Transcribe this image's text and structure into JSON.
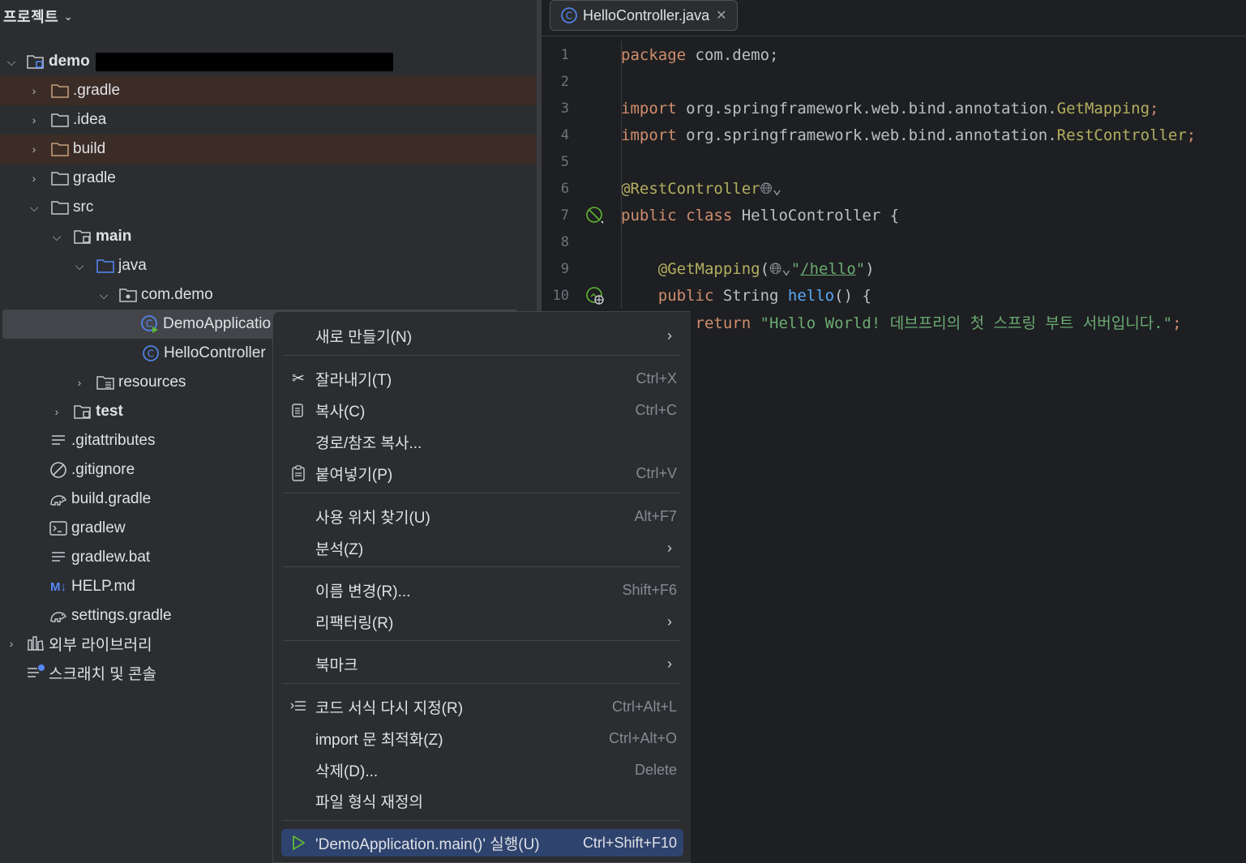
{
  "project_panel": {
    "title": "프로젝트",
    "tree": [
      {
        "label": "demo",
        "bold": true
      },
      {
        "label": ".gradle"
      },
      {
        "label": ".idea"
      },
      {
        "label": "build"
      },
      {
        "label": "gradle"
      },
      {
        "label": "src"
      },
      {
        "label": "main",
        "bold": true
      },
      {
        "label": "java"
      },
      {
        "label": "com.demo"
      },
      {
        "label": "DemoApplicatio"
      },
      {
        "label": "HelloController"
      },
      {
        "label": "resources"
      },
      {
        "label": "test",
        "bold": true
      },
      {
        "label": ".gitattributes"
      },
      {
        "label": ".gitignore"
      },
      {
        "label": "build.gradle"
      },
      {
        "label": "gradlew"
      },
      {
        "label": "gradlew.bat"
      },
      {
        "label": "HELP.md",
        "badge": "M↓"
      },
      {
        "label": "settings.gradle"
      },
      {
        "label": "외부 라이브러리"
      },
      {
        "label": "스크래치 및 콘솔"
      }
    ]
  },
  "editor": {
    "tab": {
      "label": "HelloController.java"
    },
    "code": {
      "line_numbers": [
        "1",
        "2",
        "3",
        "4",
        "5",
        "6",
        "7",
        "8",
        "9",
        "10"
      ],
      "l1_kw": "package",
      "l1_rest": " com.demo;",
      "l3_kw": "import",
      "l3_rest": " org.springframework.web.bind.annotation.",
      "l3_cls": "GetMapping",
      "l3_end": ";",
      "l4_kw": "import",
      "l4_rest": " org.springframework.web.bind.annotation.",
      "l4_cls": "RestController",
      "l4_end": ";",
      "l6_ann": "@RestController",
      "l7_kw": "public class",
      "l7_rest": " HelloController {",
      "l9_ann": "@GetMapping",
      "l9_open": "(",
      "l9_q1": "\"",
      "l9_path": "/hello",
      "l9_q2": "\"",
      "l9_close": ")",
      "l10_kw": "public",
      "l10_type": " String ",
      "l10_fn": "hello",
      "l10_rest": "() {",
      "l11_kw": "return",
      "l11_str": " \"Hello World! 데브프리의 첫 스프링 부트 서버입니다.\"",
      "l11_end": ";"
    }
  },
  "context_menu": {
    "items": [
      {
        "label": "새로 만들기(N)",
        "submenu": true
      },
      {
        "label": "잘라내기(T)",
        "shortcut": "Ctrl+X",
        "icon": "scissors-icon"
      },
      {
        "label": "복사(C)",
        "shortcut": "Ctrl+C",
        "icon": "copy-icon"
      },
      {
        "label": "경로/참조 복사..."
      },
      {
        "label": "붙여넣기(P)",
        "shortcut": "Ctrl+V",
        "icon": "paste-icon"
      },
      {
        "label": "사용 위치 찾기(U)",
        "shortcut": "Alt+F7"
      },
      {
        "label": "분석(Z)",
        "submenu": true
      },
      {
        "label": "이름 변경(R)...",
        "shortcut": "Shift+F6"
      },
      {
        "label": "리팩터링(R)",
        "submenu": true
      },
      {
        "label": "북마크",
        "submenu": true
      },
      {
        "label": "코드 서식 다시 지정(R)",
        "shortcut": "Ctrl+Alt+L",
        "icon": "reformat-icon"
      },
      {
        "label": "import 문 최적화(Z)",
        "shortcut": "Ctrl+Alt+O"
      },
      {
        "label": "삭제(D)...",
        "shortcut": "Delete"
      },
      {
        "label": "파일 형식 재정의"
      },
      {
        "label": "'DemoApplication.main()' 실행(U)",
        "shortcut": "Ctrl+Shift+F10",
        "icon": "run-icon",
        "active": true
      }
    ]
  },
  "colors": {
    "accent": "#2e436e",
    "folder": "#c8cad0",
    "java_class": "#548af7",
    "run_green": "#5fb832"
  }
}
